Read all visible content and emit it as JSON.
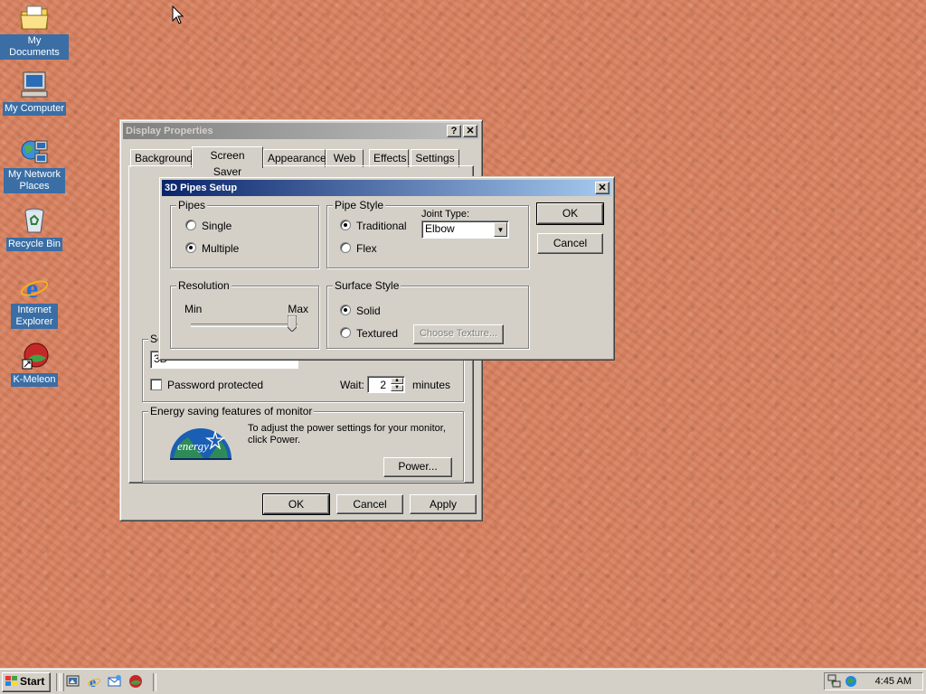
{
  "desktop": {
    "icons": [
      {
        "label": "My Documents",
        "icon": "folder-documents-icon"
      },
      {
        "label": "My Computer",
        "icon": "computer-icon"
      },
      {
        "label": "My Network Places",
        "icon": "network-places-icon"
      },
      {
        "label": "Recycle Bin",
        "icon": "recycle-bin-icon"
      },
      {
        "label": "Internet Explorer",
        "icon": "internet-explorer-icon"
      },
      {
        "label": "K-Meleon",
        "icon": "k-meleon-icon"
      }
    ]
  },
  "display_properties": {
    "title": "Display Properties",
    "tabs": [
      "Background",
      "Screen Saver",
      "Appearance",
      "Web",
      "Effects",
      "Settings"
    ],
    "selected_tab": "Screen Saver",
    "screensaver_group_title_fragment": "Sc",
    "screensaver_select_fragment": "3D",
    "password_label": "Password protected",
    "wait_label": "Wait:",
    "wait_value": "2",
    "minutes_label": "minutes",
    "energy": {
      "title": "Energy saving features of monitor",
      "text": "To adjust the power settings for your monitor, click Power.",
      "power_button": "Power..."
    },
    "buttons": {
      "ok": "OK",
      "cancel": "Cancel",
      "apply": "Apply"
    }
  },
  "pipes_setup": {
    "title": "3D Pipes Setup",
    "pipes": {
      "title": "Pipes",
      "single": "Single",
      "multiple": "Multiple",
      "selected": "Multiple"
    },
    "pipe_style": {
      "title": "Pipe Style",
      "traditional": "Traditional",
      "flex": "Flex",
      "selected": "Traditional",
      "joint_type_label": "Joint Type:",
      "joint_type_value": "Elbow"
    },
    "resolution": {
      "title": "Resolution",
      "min": "Min",
      "max": "Max",
      "level": 0.95
    },
    "surface_style": {
      "title": "Surface Style",
      "solid": "Solid",
      "textured": "Textured",
      "selected": "Solid",
      "choose_texture": "Choose Texture..."
    },
    "buttons": {
      "ok": "OK",
      "cancel": "Cancel"
    }
  },
  "taskbar": {
    "start_label": "Start",
    "quick_launch": [
      "show-desktop-icon",
      "internet-explorer-icon",
      "outlook-express-icon",
      "k-meleon-icon"
    ],
    "tray_icons": [
      "network-icon",
      "volume-icon"
    ],
    "clock": "4:45 AM"
  }
}
